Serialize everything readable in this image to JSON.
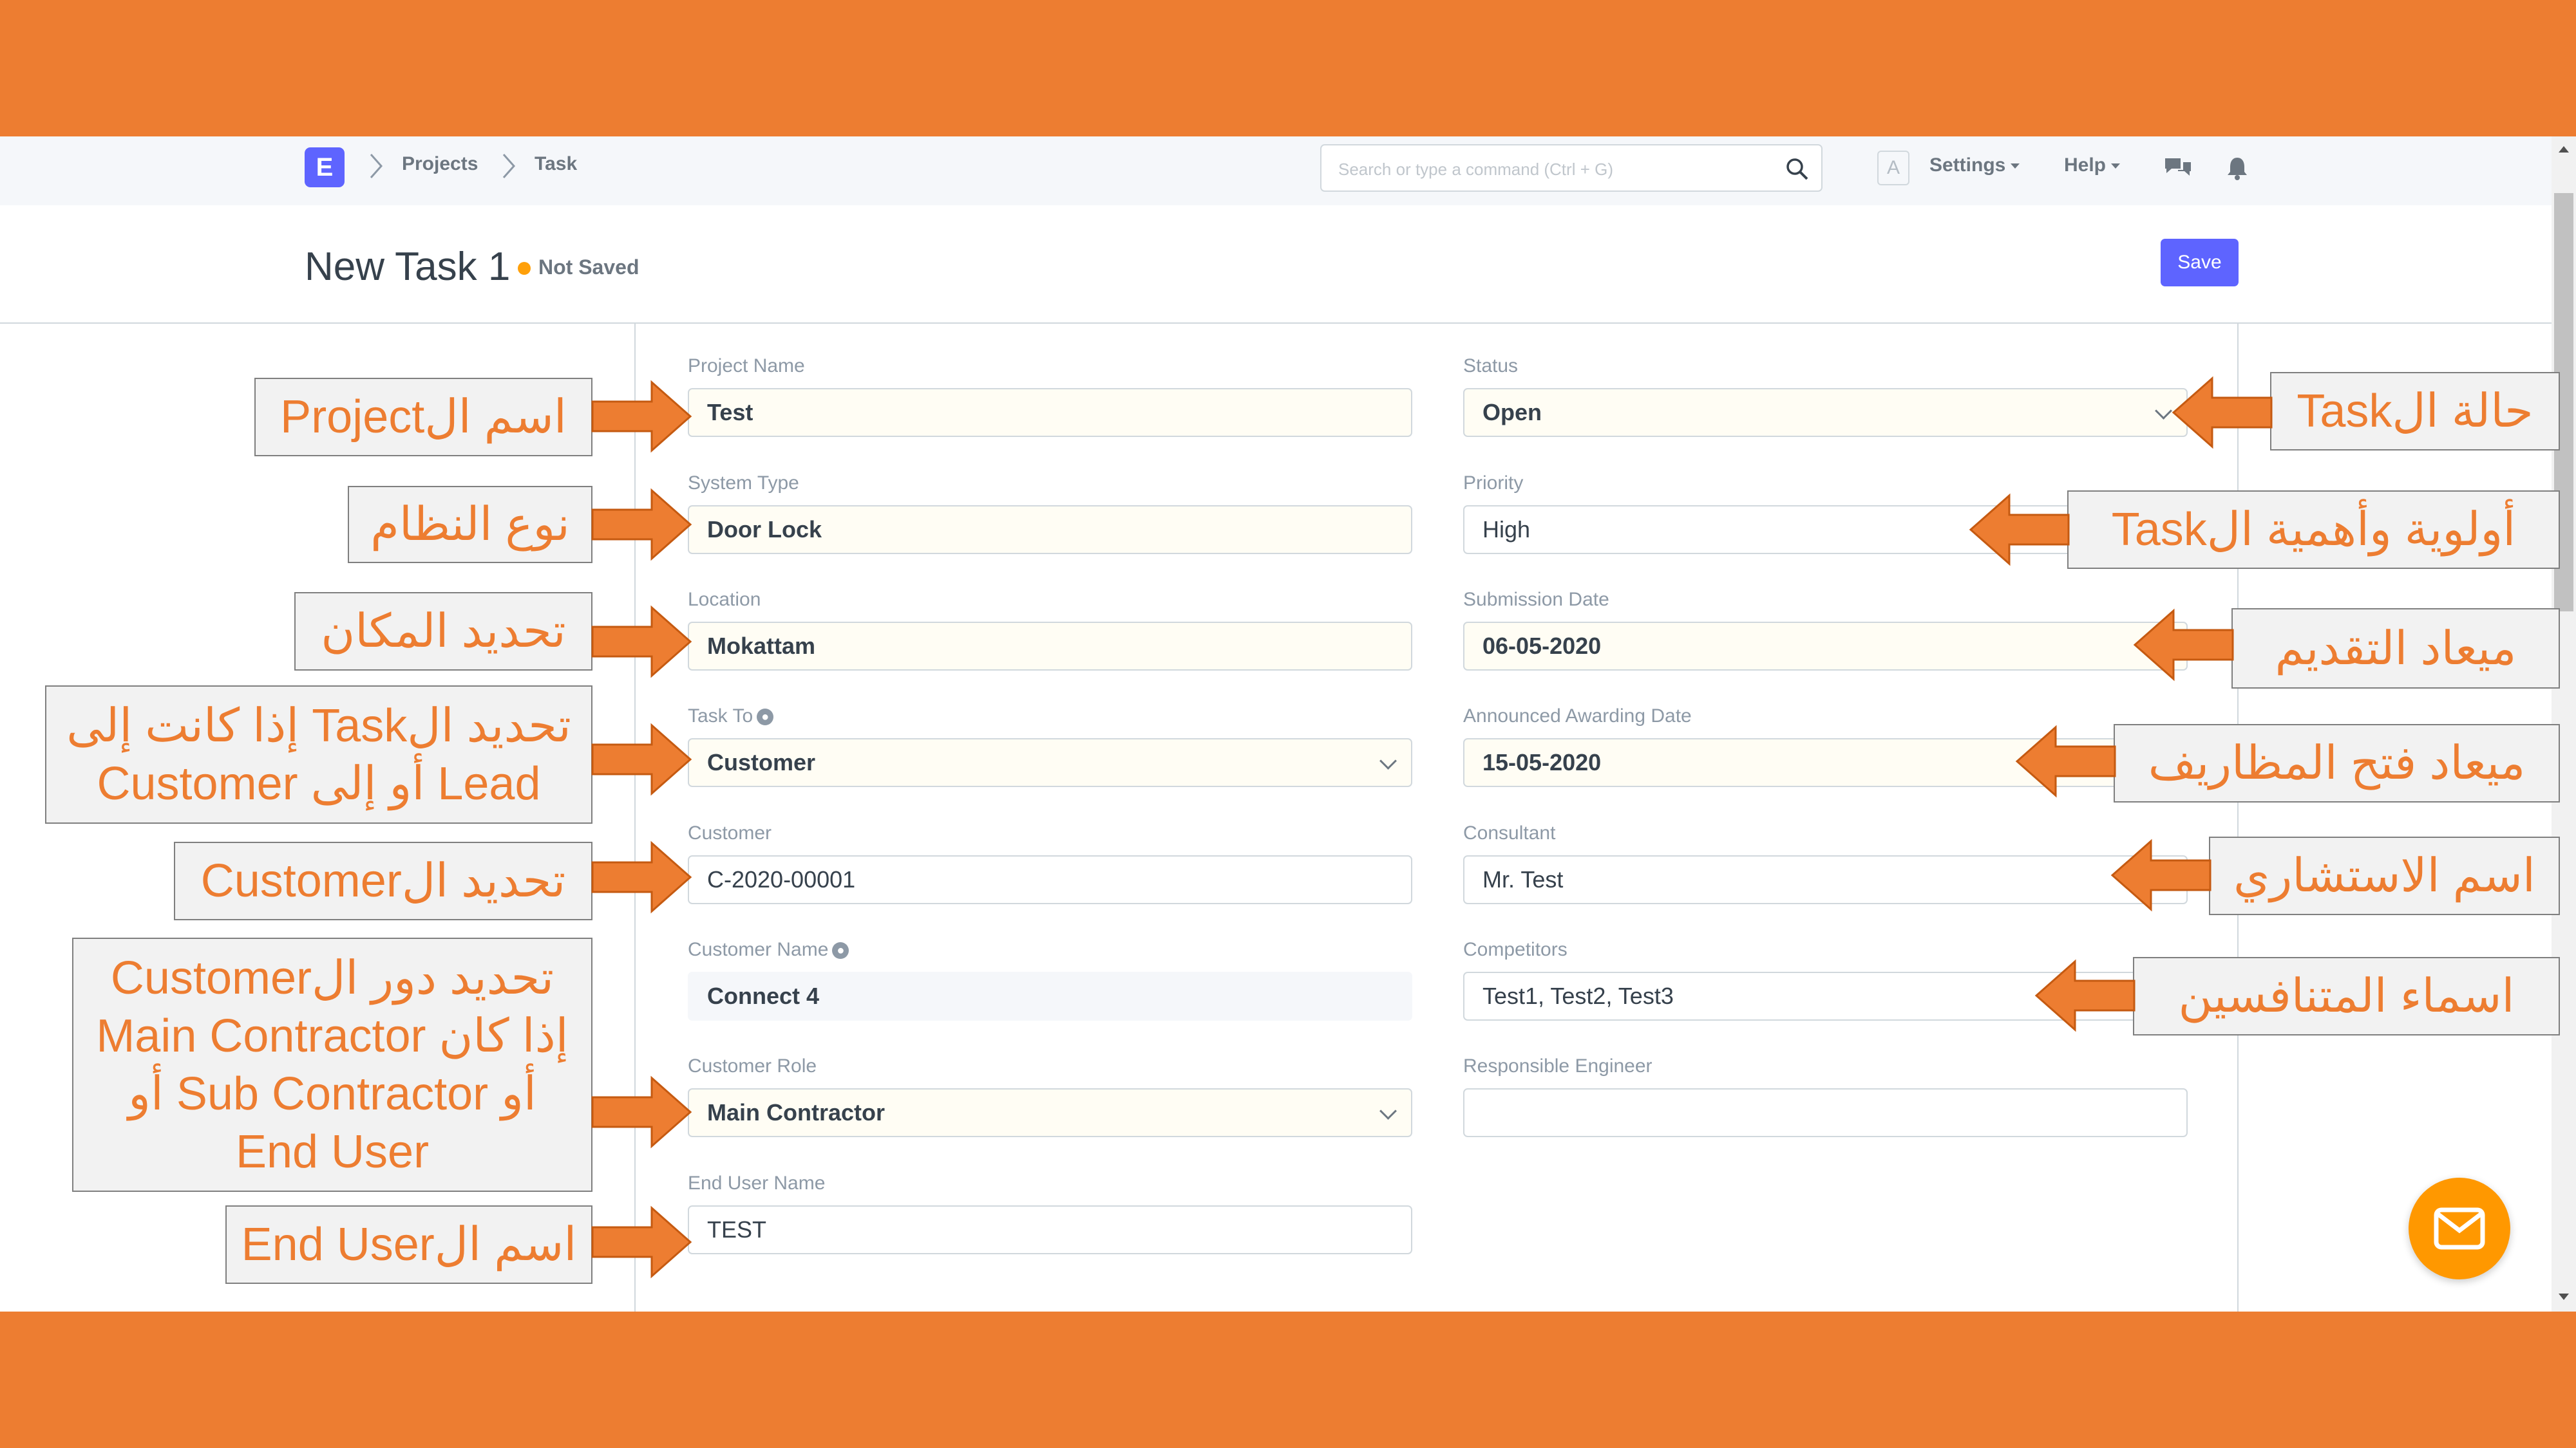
{
  "navbar": {
    "logo_letter": "E",
    "breadcrumbs": [
      "Projects",
      "Task"
    ],
    "search_placeholder": "Search or type a command (Ctrl + G)",
    "avatar_letter": "A",
    "settings_label": "Settings",
    "help_label": "Help"
  },
  "page": {
    "title": "New Task 1",
    "status": "Not Saved",
    "save_label": "Save"
  },
  "form": {
    "project_name": {
      "label": "Project Name",
      "value": "Test"
    },
    "system_type": {
      "label": "System Type",
      "value": "Door Lock"
    },
    "location": {
      "label": "Location",
      "value": "Mokattam"
    },
    "task_to": {
      "label": "Task To",
      "value": "Customer"
    },
    "customer": {
      "label": "Customer",
      "value": "C-2020-00001"
    },
    "customer_name": {
      "label": "Customer Name",
      "value": "Connect 4"
    },
    "customer_role": {
      "label": "Customer Role",
      "value": "Main Contractor"
    },
    "end_user_name": {
      "label": "End User Name",
      "value": "TEST"
    },
    "status": {
      "label": "Status",
      "value": "Open"
    },
    "priority": {
      "label": "Priority",
      "value": "High"
    },
    "submission_date": {
      "label": "Submission Date",
      "value": "06-05-2020"
    },
    "awarding_date": {
      "label": "Announced Awarding Date",
      "value": "15-05-2020"
    },
    "consultant": {
      "label": "Consultant",
      "value": "Mr. Test"
    },
    "competitors": {
      "label": "Competitors",
      "value": "Test1, Test2, Test3"
    },
    "responsible_engineer": {
      "label": "Responsible Engineer",
      "value": ""
    }
  },
  "callouts": {
    "project_name": "اسم الProject",
    "system_type": "نوع النظام",
    "location": "تحديد المكان",
    "task_to_line1": "تحديد الTask إذا كانت إلى",
    "task_to_line2": "Lead أو إلى Customer",
    "customer": "تحديد الCustomer",
    "customer_role_line1": "تحديد دور الCustomer",
    "customer_role_line2": "إذا كان Main Contractor",
    "customer_role_line3": "أو Sub Contractor أو",
    "customer_role_line4": "End User",
    "end_user": "اسم الEnd User",
    "status": "حالة الTask",
    "priority": "أولوية وأهمية الTask",
    "submission_date": "ميعاد التقديم",
    "awarding_date": "ميعاد فتح المظاريف",
    "consultant": "اسم الاستشاري",
    "competitors": "اسماء المتنافسين"
  },
  "colors": {
    "accent": "#ED7D31",
    "primary": "#5E64FF",
    "warning": "#FFA00A",
    "fab": "#FF9800"
  },
  "icons": [
    "search-icon",
    "chat-icon",
    "bell-icon",
    "globe-icon",
    "mail-icon",
    "chevron-down-icon"
  ]
}
